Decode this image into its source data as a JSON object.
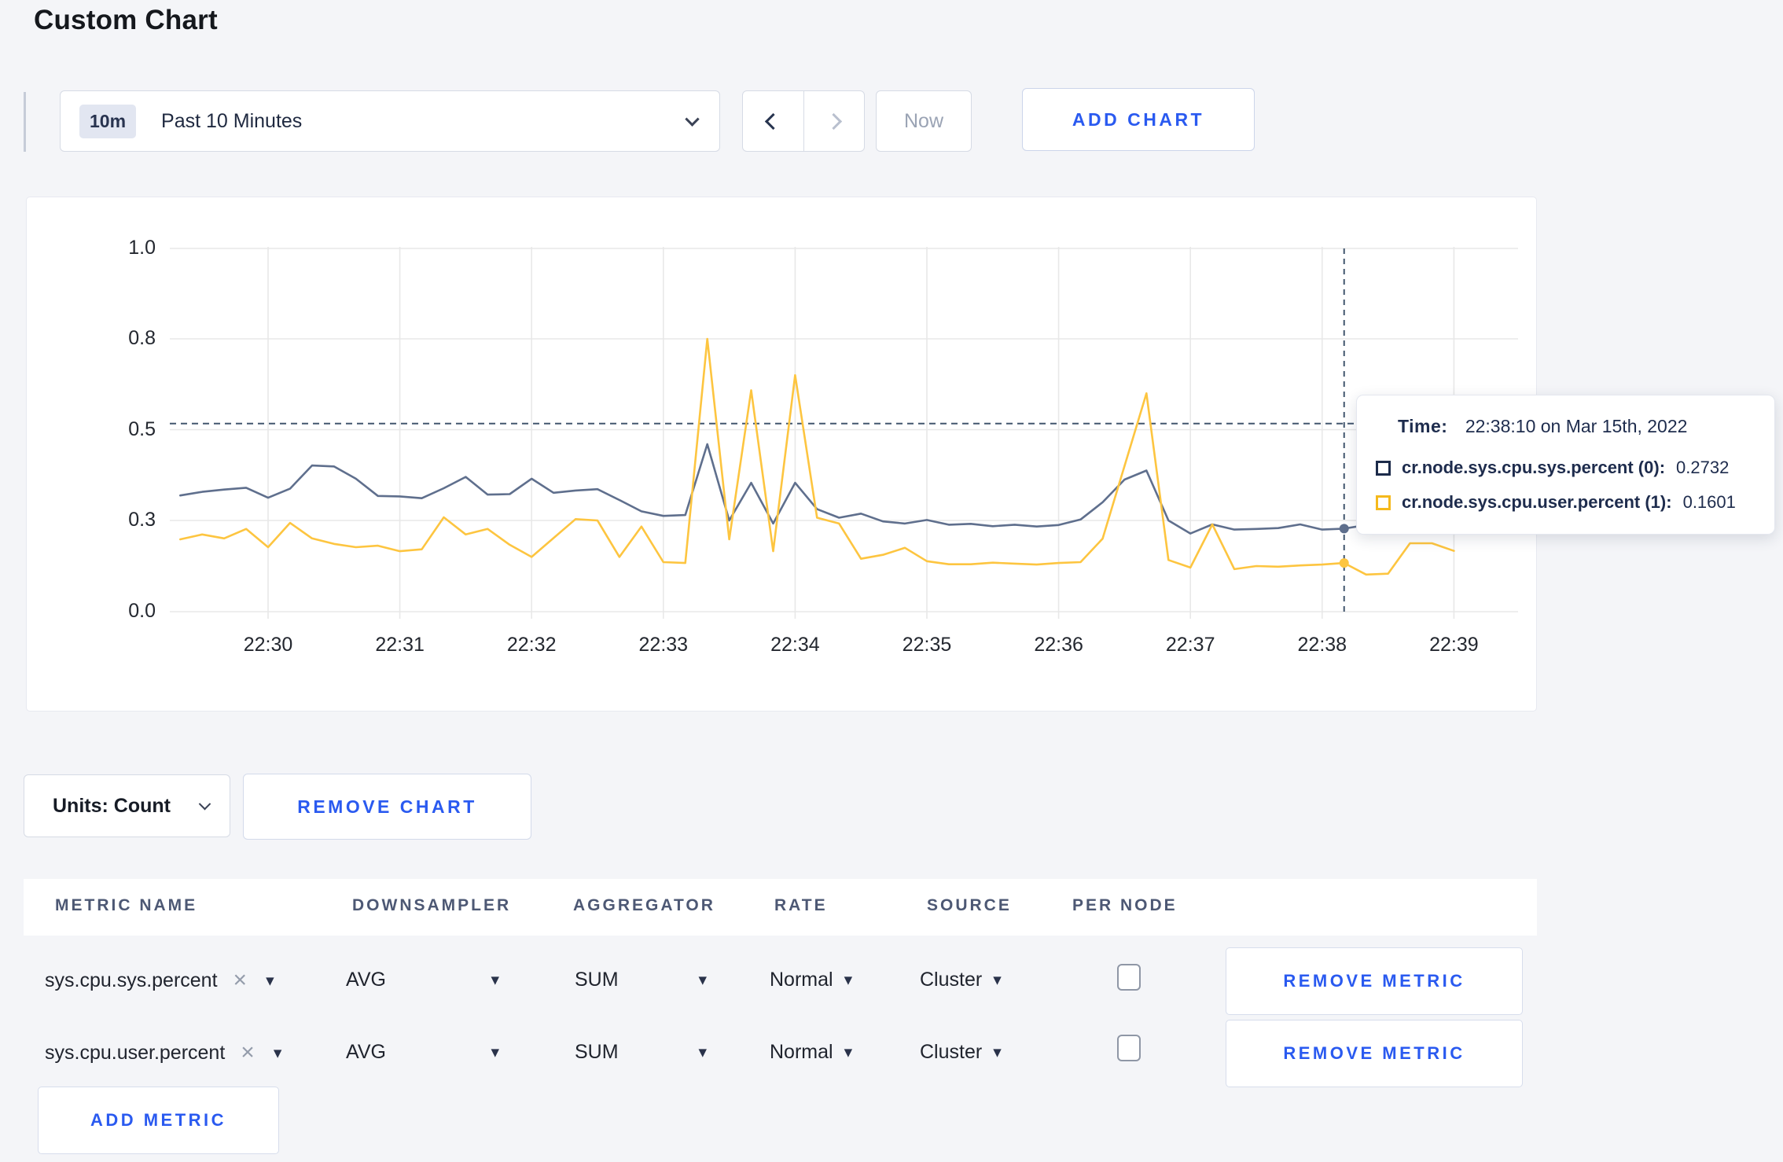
{
  "page": {
    "title": "Custom Chart",
    "background": "#f4f5f8"
  },
  "colors": {
    "accent_blue": "#2a5af0",
    "series_sys": "#5f6f8d",
    "series_user": "#fdc540",
    "swatch_sys": "#1c2b4a",
    "swatch_user": "#f5b91c",
    "crosshair": "#42566e",
    "gridline": "#e8e8e8"
  },
  "toolbar": {
    "time_badge": "10m",
    "time_label": "Past 10 Minutes",
    "now_label": "Now",
    "add_chart_label": "ADD CHART"
  },
  "chart_data": {
    "type": "line",
    "title": "",
    "xlabel": "",
    "ylabel": "",
    "ylim": [
      0,
      1
    ],
    "grid": true,
    "y_ticks": [
      "1.0",
      "0.8",
      "0.5",
      "0.3",
      "0.0"
    ],
    "x_ticks": [
      "22:30",
      "22:31",
      "22:32",
      "22:33",
      "22:34",
      "22:35",
      "22:36",
      "22:37",
      "22:38",
      "22:39"
    ],
    "crosshair": {
      "time": "22:38:10",
      "y_value": 0.52,
      "values": [
        0.2732,
        0.1601
      ]
    },
    "series": [
      {
        "name": "cr.node.sys.cpu.sys.percent (0)",
        "color": "#5f6f8d",
        "points": [
          [
            "22:29:20",
            0.355
          ],
          [
            "22:29:30",
            0.363
          ],
          [
            "22:29:40",
            0.368
          ],
          [
            "22:29:50",
            0.372
          ],
          [
            "22:30:00",
            0.35
          ],
          [
            "22:30:10",
            0.37
          ],
          [
            "22:30:20",
            0.421
          ],
          [
            "22:30:30",
            0.419
          ],
          [
            "22:30:40",
            0.392
          ],
          [
            "22:30:50",
            0.354
          ],
          [
            "22:31:00",
            0.353
          ],
          [
            "22:31:10",
            0.349
          ],
          [
            "22:31:20",
            0.371
          ],
          [
            "22:31:30",
            0.396
          ],
          [
            "22:31:40",
            0.357
          ],
          [
            "22:31:50",
            0.358
          ],
          [
            "22:32:00",
            0.392
          ],
          [
            "22:32:10",
            0.361
          ],
          [
            "22:32:20",
            0.366
          ],
          [
            "22:32:30",
            0.369
          ],
          [
            "22:32:40",
            0.345
          ],
          [
            "22:32:50",
            0.32
          ],
          [
            "22:33:00",
            0.31
          ],
          [
            "22:33:10",
            0.312
          ],
          [
            "22:33:20",
            0.468
          ],
          [
            "22:33:30",
            0.3
          ],
          [
            "22:33:40",
            0.383
          ],
          [
            "22:33:50",
            0.29
          ],
          [
            "22:34:00",
            0.383
          ],
          [
            "22:34:10",
            0.325
          ],
          [
            "22:34:20",
            0.306
          ],
          [
            "22:34:30",
            0.315
          ],
          [
            "22:34:40",
            0.297
          ],
          [
            "22:34:50",
            0.29
          ],
          [
            "22:35:00",
            0.301
          ],
          [
            "22:35:10",
            0.286
          ],
          [
            "22:35:20",
            0.289
          ],
          [
            "22:35:30",
            0.281
          ],
          [
            "22:35:40",
            0.286
          ],
          [
            "22:35:50",
            0.28
          ],
          [
            "22:36:00",
            0.285
          ],
          [
            "22:36:10",
            0.302
          ],
          [
            "22:36:20",
            0.34
          ],
          [
            "22:36:30",
            0.39
          ],
          [
            "22:36:40",
            0.41
          ],
          [
            "22:36:50",
            0.3
          ],
          [
            "22:37:00",
            0.257
          ],
          [
            "22:37:10",
            0.287
          ],
          [
            "22:37:20",
            0.27
          ],
          [
            "22:37:30",
            0.272
          ],
          [
            "22:37:40",
            0.275
          ],
          [
            "22:37:50",
            0.287
          ],
          [
            "22:38:00",
            0.27
          ],
          [
            "22:38:10",
            0.2732
          ],
          [
            "22:38:20",
            0.285
          ],
          [
            "22:38:30",
            0.295
          ],
          [
            "22:38:40",
            0.301
          ],
          [
            "22:38:50",
            0.296
          ],
          [
            "22:39:00",
            0.3
          ]
        ]
      },
      {
        "name": "cr.node.sys.cpu.user.percent (1)",
        "color": "#fdc540",
        "points": [
          [
            "22:29:20",
            0.238
          ],
          [
            "22:29:30",
            0.254
          ],
          [
            "22:29:40",
            0.241
          ],
          [
            "22:29:50",
            0.272
          ],
          [
            "22:30:00",
            0.212
          ],
          [
            "22:30:10",
            0.292
          ],
          [
            "22:30:20",
            0.241
          ],
          [
            "22:30:30",
            0.223
          ],
          [
            "22:30:40",
            0.212
          ],
          [
            "22:30:50",
            0.217
          ],
          [
            "22:31:00",
            0.199
          ],
          [
            "22:31:10",
            0.205
          ],
          [
            "22:31:20",
            0.307
          ],
          [
            "22:31:30",
            0.254
          ],
          [
            "22:31:40",
            0.272
          ],
          [
            "22:31:50",
            0.22
          ],
          [
            "22:32:00",
            0.18
          ],
          [
            "22:32:10",
            0.242
          ],
          [
            "22:32:20",
            0.303
          ],
          [
            "22:32:30",
            0.3
          ],
          [
            "22:32:40",
            0.18
          ],
          [
            "22:32:50",
            0.28
          ],
          [
            "22:33:00",
            0.163
          ],
          [
            "22:33:10",
            0.16
          ],
          [
            "22:33:20",
            0.8
          ],
          [
            "22:33:30",
            0.238
          ],
          [
            "22:33:40",
            0.63
          ],
          [
            "22:33:50",
            0.199
          ],
          [
            "22:34:00",
            0.68
          ],
          [
            "22:34:10",
            0.306
          ],
          [
            "22:34:20",
            0.29
          ],
          [
            "22:34:30",
            0.174
          ],
          [
            "22:34:40",
            0.187
          ],
          [
            "22:34:50",
            0.21
          ],
          [
            "22:35:00",
            0.166
          ],
          [
            "22:35:10",
            0.156
          ],
          [
            "22:35:20",
            0.156
          ],
          [
            "22:35:30",
            0.161
          ],
          [
            "22:35:40",
            0.158
          ],
          [
            "22:35:50",
            0.155
          ],
          [
            "22:36:00",
            0.16
          ],
          [
            "22:36:10",
            0.163
          ],
          [
            "22:36:20",
            0.24
          ],
          [
            "22:36:30",
            0.42
          ],
          [
            "22:36:40",
            0.62
          ],
          [
            "22:36:50",
            0.17
          ],
          [
            "22:37:00",
            0.145
          ],
          [
            "22:37:10",
            0.287
          ],
          [
            "22:37:20",
            0.14
          ],
          [
            "22:37:30",
            0.15
          ],
          [
            "22:37:40",
            0.148
          ],
          [
            "22:37:50",
            0.152
          ],
          [
            "22:38:00",
            0.155
          ],
          [
            "22:38:10",
            0.1601
          ],
          [
            "22:38:20",
            0.122
          ],
          [
            "22:38:30",
            0.125
          ],
          [
            "22:38:40",
            0.225
          ],
          [
            "22:38:50",
            0.225
          ],
          [
            "22:39:00",
            0.2
          ]
        ]
      }
    ]
  },
  "tooltip": {
    "time_label": "Time:",
    "time_value": "22:38:10 on Mar 15th, 2022",
    "rows": [
      {
        "label": "cr.node.sys.cpu.sys.percent (0):",
        "value": "0.2732",
        "color": "#1c2b4a"
      },
      {
        "label": "cr.node.sys.cpu.user.percent (1):",
        "value": "0.1601",
        "color": "#f5b91c"
      }
    ]
  },
  "units_bar": {
    "units_label": "Units: Count",
    "remove_chart_label": "REMOVE CHART"
  },
  "metrics_table": {
    "headers": [
      "METRIC NAME",
      "DOWNSAMPLER",
      "AGGREGATOR",
      "RATE",
      "SOURCE",
      "PER NODE"
    ],
    "rows": [
      {
        "metric": "sys.cpu.sys.percent",
        "downsampler": "AVG",
        "aggregator": "SUM",
        "rate": "Normal",
        "source": "Cluster",
        "per_node_checked": false,
        "remove_label": "REMOVE METRIC"
      },
      {
        "metric": "sys.cpu.user.percent",
        "downsampler": "AVG",
        "aggregator": "SUM",
        "rate": "Normal",
        "source": "Cluster",
        "per_node_checked": false,
        "remove_label": "REMOVE METRIC"
      }
    ],
    "add_metric_label": "ADD METRIC"
  }
}
